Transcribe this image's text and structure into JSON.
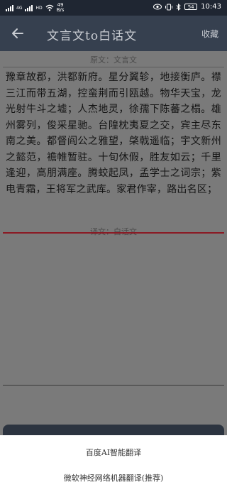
{
  "status_bar": {
    "net_speed_value": "49",
    "net_speed_unit": "B/s",
    "time": "10:43",
    "battery": "54",
    "tag_4g": "4G",
    "tag_hd": "HD",
    "icons": [
      "signal-icon",
      "wifi-icon",
      "eye-icon",
      "vibrate-icon",
      "bluetooth-icon",
      "battery-icon"
    ]
  },
  "app_bar": {
    "title": "文言文to白话文",
    "collect_label": "收藏",
    "back_icon": "arrow-left-icon"
  },
  "original": {
    "label": "原文：文言文",
    "text": "豫章故郡，洪都新府。星分翼轸，地接衡庐。襟三江而带五湖，控蛮荆而引瓯越。物华天宝，龙光射牛斗之墟；人杰地灵，徐孺下陈蕃之榻。雄州雾列，俊采星驰。台隍枕夷夏之交，宾主尽东南之美。都督阎公之雅望，棨戟遥临；宇文新州之懿范，襜帷暂驻。十旬休假，胜友如云；千里逢迎，高朋满座。腾蛟起凤，孟学士之词宗；紫电青霜，王将军之武库。家君作宰，路出名区；"
  },
  "translation": {
    "label": "译文：白话文"
  },
  "sheet": {
    "option_baidu": "百度AI智能翻译",
    "option_ms": "微软神经网络机器翻译(推荐)"
  },
  "colors": {
    "status_bg": "#1f2632",
    "app_bar_bg": "#36404f",
    "overlay_bg": "#7a7a7a",
    "accent_line": "#8a1a24",
    "sheet_bg": "#ffffff"
  }
}
